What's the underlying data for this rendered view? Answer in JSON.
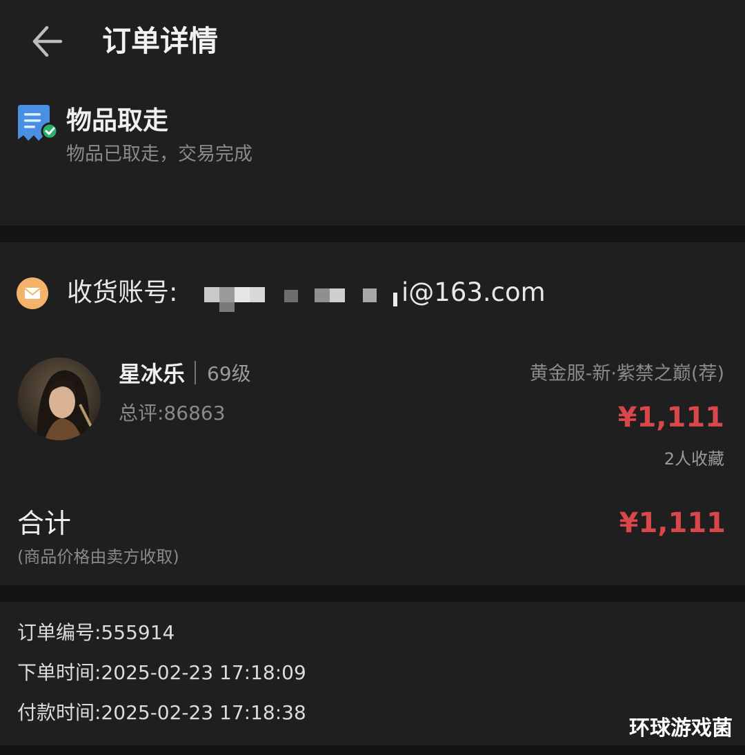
{
  "header": {
    "title": "订单详情",
    "back_icon": "arrow-left-icon"
  },
  "status": {
    "icon": "receipt-check-icon",
    "title": "物品取走",
    "description": "物品已取走，交易完成"
  },
  "account": {
    "icon": "mail-icon",
    "label": "收货账号:",
    "masked": true,
    "visible_suffix": "i@163.com"
  },
  "item": {
    "seller_name": "星冰乐",
    "seller_level": "69级",
    "rating": "总评:86863",
    "server": "黄金服-新·紫禁之巅(荐)",
    "price": "¥1,111",
    "favorites": "2人收藏"
  },
  "total": {
    "label": "合计",
    "note": "(商品价格由卖方收取)",
    "price": "¥1,111"
  },
  "order_info": [
    "订单编号:555914",
    "下单时间:2025-02-23 17:18:09",
    "付款时间:2025-02-23 17:18:38"
  ],
  "watermark": "环球游戏菌",
  "colors": {
    "background": "#141414",
    "panel": "#1f1f1f",
    "price": "#d9474a",
    "status_icon": "#4a90e2",
    "check": "#29b06a",
    "mail_icon": "#f3b36a"
  }
}
